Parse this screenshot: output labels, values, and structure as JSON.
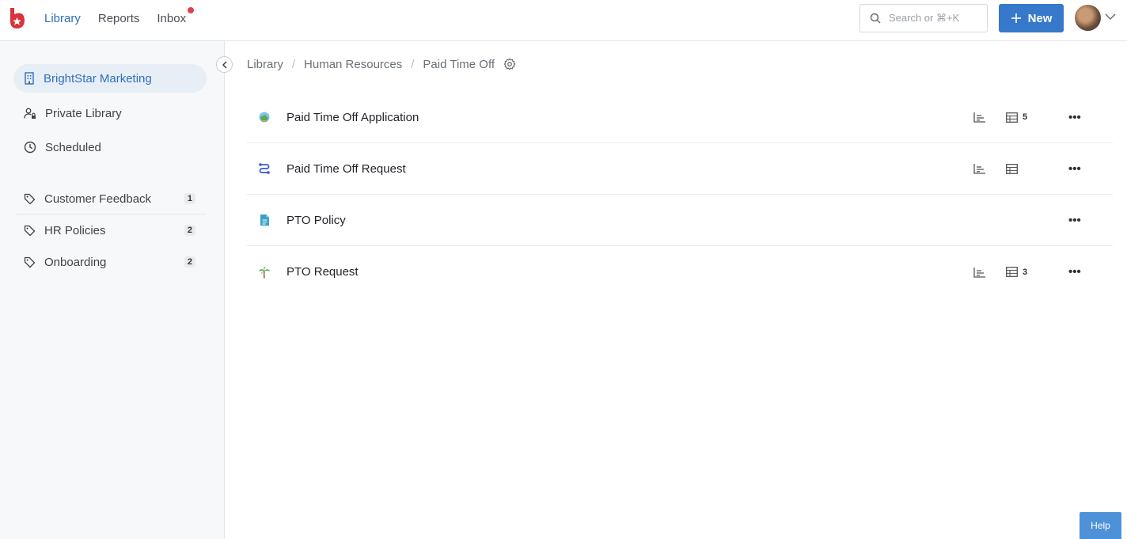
{
  "header": {
    "nav": [
      {
        "label": "Library",
        "active": true
      },
      {
        "label": "Reports",
        "active": false
      },
      {
        "label": "Inbox",
        "active": false,
        "has_notification": true
      }
    ],
    "search_placeholder": "Search or ⌘+K",
    "new_label": "New",
    "brand_color": "#3678c9"
  },
  "sidebar": {
    "primary": [
      {
        "label": "BrightStar Marketing",
        "icon": "building-icon",
        "active": true
      },
      {
        "label": "Private Library",
        "icon": "user-lock-icon",
        "active": false
      },
      {
        "label": "Scheduled",
        "icon": "clock-icon",
        "active": false
      }
    ],
    "tags": [
      {
        "label": "Customer Feedback",
        "count": "1"
      },
      {
        "label": "HR Policies",
        "count": "2"
      },
      {
        "label": "Onboarding",
        "count": "2"
      }
    ]
  },
  "breadcrumb": [
    "Library",
    "Human Resources",
    "Paid Time Off"
  ],
  "items": [
    {
      "name": "Paid Time Off Application",
      "icon": "globe-island-icon",
      "has_chart": true,
      "has_table": true,
      "table_count": "5"
    },
    {
      "name": "Paid Time Off Request",
      "icon": "workflow-icon",
      "has_chart": true,
      "has_table": true,
      "table_count": ""
    },
    {
      "name": "PTO Policy",
      "icon": "document-icon",
      "has_chart": false,
      "has_table": false,
      "table_count": ""
    },
    {
      "name": "PTO Request",
      "icon": "palm-tree-icon",
      "has_chart": true,
      "has_table": true,
      "table_count": "3"
    }
  ],
  "more_label": "•••",
  "help_label": "Help"
}
